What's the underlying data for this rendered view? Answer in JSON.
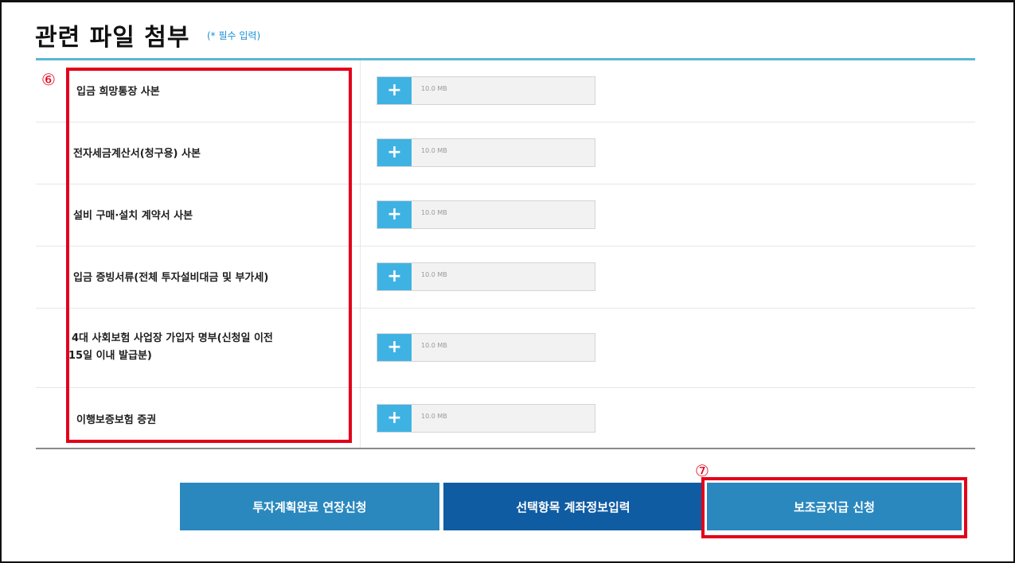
{
  "section": {
    "title": "관련 파일 첨부",
    "required_note": "(* 필수 입력)"
  },
  "markers": {
    "six": "⑥",
    "seven": "⑦"
  },
  "files": [
    {
      "label": "입금 희망통장 사본",
      "size": "10.0 MB"
    },
    {
      "label": "전자세금계산서(청구용) 사본",
      "size": "10.0 MB"
    },
    {
      "label": "설비 구매·설치 계약서 사본",
      "size": "10.0 MB"
    },
    {
      "label": "입금 증빙서류(전체 투자설비대금 및 부가세)",
      "size": "10.0 MB"
    },
    {
      "label_line1": "4대 사회보험 사업장 가입자 명부(신청일 이전",
      "label_line2": "15일 이내 발급분)",
      "size": "10.0 MB"
    },
    {
      "label": "이행보증보험 증권",
      "size": "10.0 MB"
    }
  ],
  "upload_icon": "plus-icon",
  "buttons": {
    "extension": "투자계획완료 연장신청",
    "account_info": "선택항목 계좌정보입력",
    "subsidy_request": "보조금지급 신청"
  },
  "colors": {
    "accent_blue": "#3fb2e4",
    "button_blue": "#2a88bf",
    "button_dark_blue": "#0f5ca3",
    "highlight_red": "#e3001a",
    "required_note": "#1b8fd3"
  }
}
